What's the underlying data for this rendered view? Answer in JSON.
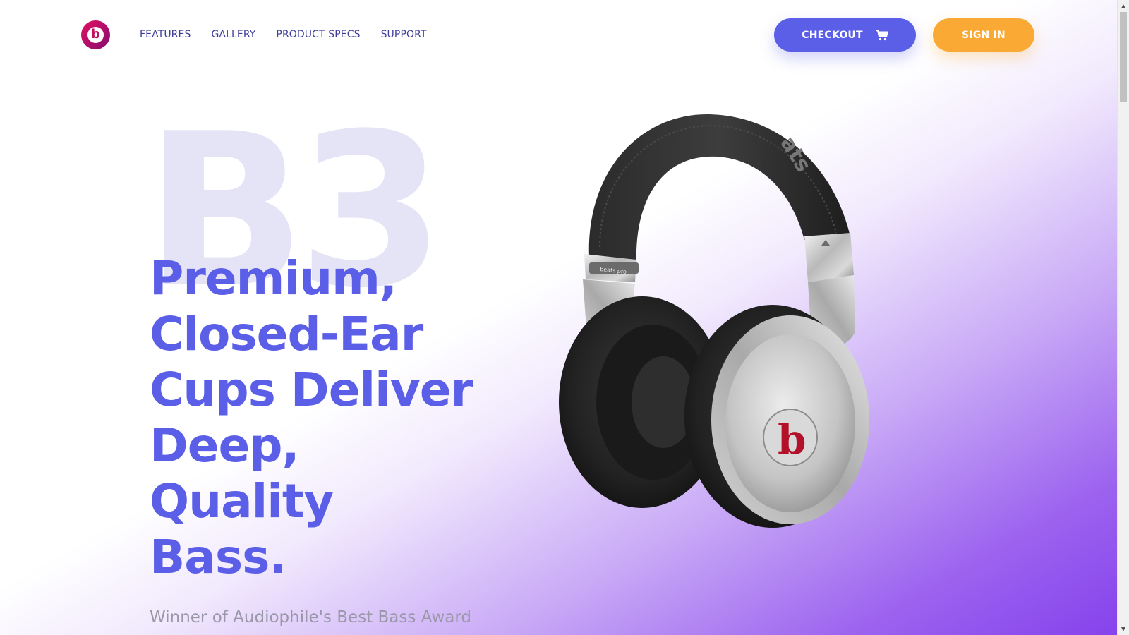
{
  "brand": {
    "logo_letter": "b",
    "colors": {
      "logo": "#c0105f",
      "accent": "#5b5fe8",
      "signin": "#fba935",
      "gradient_end": "#8642ec"
    }
  },
  "nav": {
    "items": [
      {
        "label": "FEATURES"
      },
      {
        "label": "GALLERY"
      },
      {
        "label": "PRODUCT SPECS"
      },
      {
        "label": "SUPPORT"
      }
    ]
  },
  "header": {
    "checkout_label": "CHECKOUT",
    "checkout_icon": "cart-icon",
    "signin_label": "SIGN IN"
  },
  "hero": {
    "model": "B3",
    "headline_lines": [
      "Premium,",
      "Closed-Ear",
      "Cups Deliver",
      "Deep,",
      "Quality",
      "Bass."
    ],
    "subline": "Winner of Audiophile's Best Bass Award",
    "product_image": "headphones-image",
    "product_labels": {
      "headband_text": "ats",
      "hinge_text": "beats pro",
      "earcup_letter": "b"
    }
  }
}
